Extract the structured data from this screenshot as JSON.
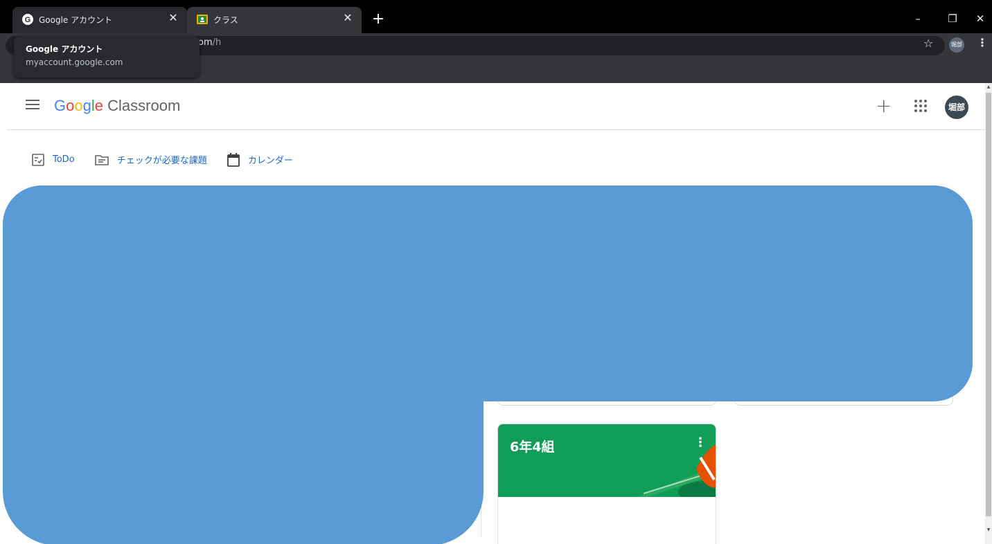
{
  "browser": {
    "tabs": [
      {
        "title": "Google アカウント",
        "close": "✕"
      },
      {
        "title": "クラス",
        "close": "✕"
      }
    ],
    "new_tab": "+",
    "window_controls": {
      "minimize": "–",
      "restore": "❐",
      "close": "✕"
    },
    "url_visible": "om",
    "url_path": "/h",
    "bookmark_star": "☆",
    "profile_initials": "堀部",
    "menu": "⋮",
    "hover_card": {
      "title": "Google アカウント",
      "url": "myaccount.google.com"
    }
  },
  "header": {
    "logo_word": {
      "G": "G",
      "o1": "o",
      "o2": "o",
      "g": "g",
      "l": "l",
      "e": "e"
    },
    "product": "Classroom",
    "create": "+",
    "avatar": "堀部"
  },
  "subnav": [
    {
      "label": "ToDo",
      "icon": "todo-icon"
    },
    {
      "label": "チェックが必要な課題",
      "icon": "review-icon"
    },
    {
      "label": "カレンダー",
      "icon": "calendar-icon"
    }
  ],
  "class_card": {
    "name": "6年4組",
    "menu": "⋮"
  },
  "colors": {
    "accent": "#1967d2",
    "banner": "#0f9d58",
    "redaction": "#5b9bd5"
  }
}
